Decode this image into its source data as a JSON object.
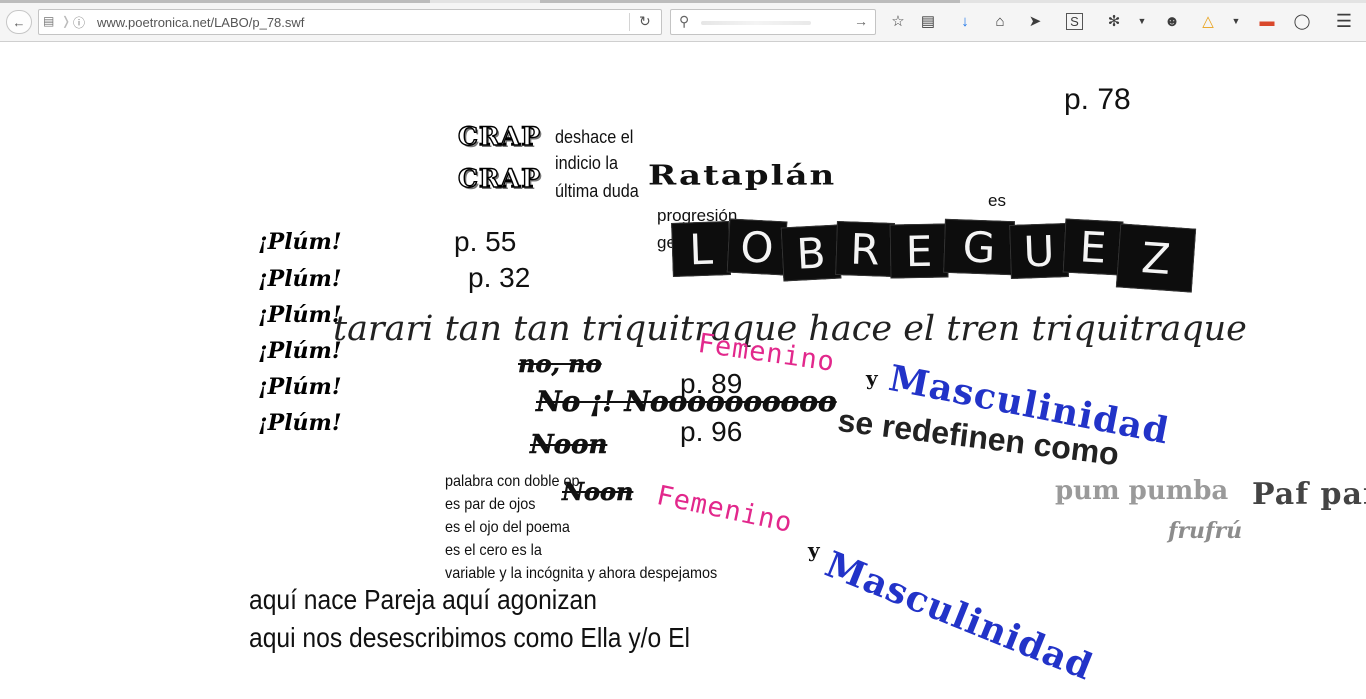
{
  "browser": {
    "url": "www.poetronica.net/LABO/p_78.swf",
    "icons": [
      "back-icon",
      "downloads-icon",
      "info-icon",
      "reload-icon",
      "search-icon",
      "go-arrow-icon",
      "bookmark-star-icon",
      "reading-list-icon",
      "download-arrow-icon",
      "home-icon",
      "send-icon",
      "screenshot-icon",
      "extension-icon",
      "dropdown-icon",
      "chat-icon",
      "color-icon",
      "dropdown-icon",
      "pen-icon",
      "pocket-icon",
      "menu-icon"
    ]
  },
  "poem": {
    "page_label": "p. 78",
    "crap_1": "CRAP",
    "crap_2": "CRAP",
    "deshace_lines": [
      "deshace el",
      "indicio la",
      "última duda"
    ],
    "rataplan": "Rataplán",
    "es": "es",
    "progresion": "progresión",
    "ge": "ge",
    "lobreguez_letters": [
      "L",
      "O",
      "B",
      "R",
      "E",
      "G",
      "U",
      "E",
      "Z"
    ],
    "plum": [
      "¡Plúm!",
      "¡Plúm!",
      "¡Plúm!",
      "¡Plúm!",
      "¡Plúm!",
      "¡Plúm!"
    ],
    "p55": "p. 55",
    "p32": "p. 32",
    "tarari": "tarari tan tan triquitraque hace el tren triquitraque",
    "nono": "no, no",
    "noi": "No ¡! Noooooooooo",
    "noon_1": "Noon",
    "noon_2": "Noon",
    "p89": "p. 89",
    "p96": "p.  96",
    "femenino_1": "Femenino",
    "y_1": "y",
    "masculinidad_1": "Masculinidad",
    "redefinen": "se redefinen como",
    "pum": "pum pumba",
    "paf": "Paf paf",
    "frufru": "frufrú",
    "palabra_lines": [
      "palabra con doble op",
      "es par de ojos",
      "es el ojo del poema",
      "es el cero es la",
      "variable y la incógnita y ahora despejamos"
    ],
    "femenino_2": "Femenino",
    "y_2": "y",
    "masculinidad_2": "Masculinidad",
    "pareja_lines": [
      "aquí nace Pareja aquí agonizan",
      "aqui nos desescribimos como Ella y/o El"
    ]
  },
  "colors": {
    "femenino": "#e2288c",
    "masculinidad": "#2233c8",
    "chrome_bg": "#f5f5f5"
  }
}
